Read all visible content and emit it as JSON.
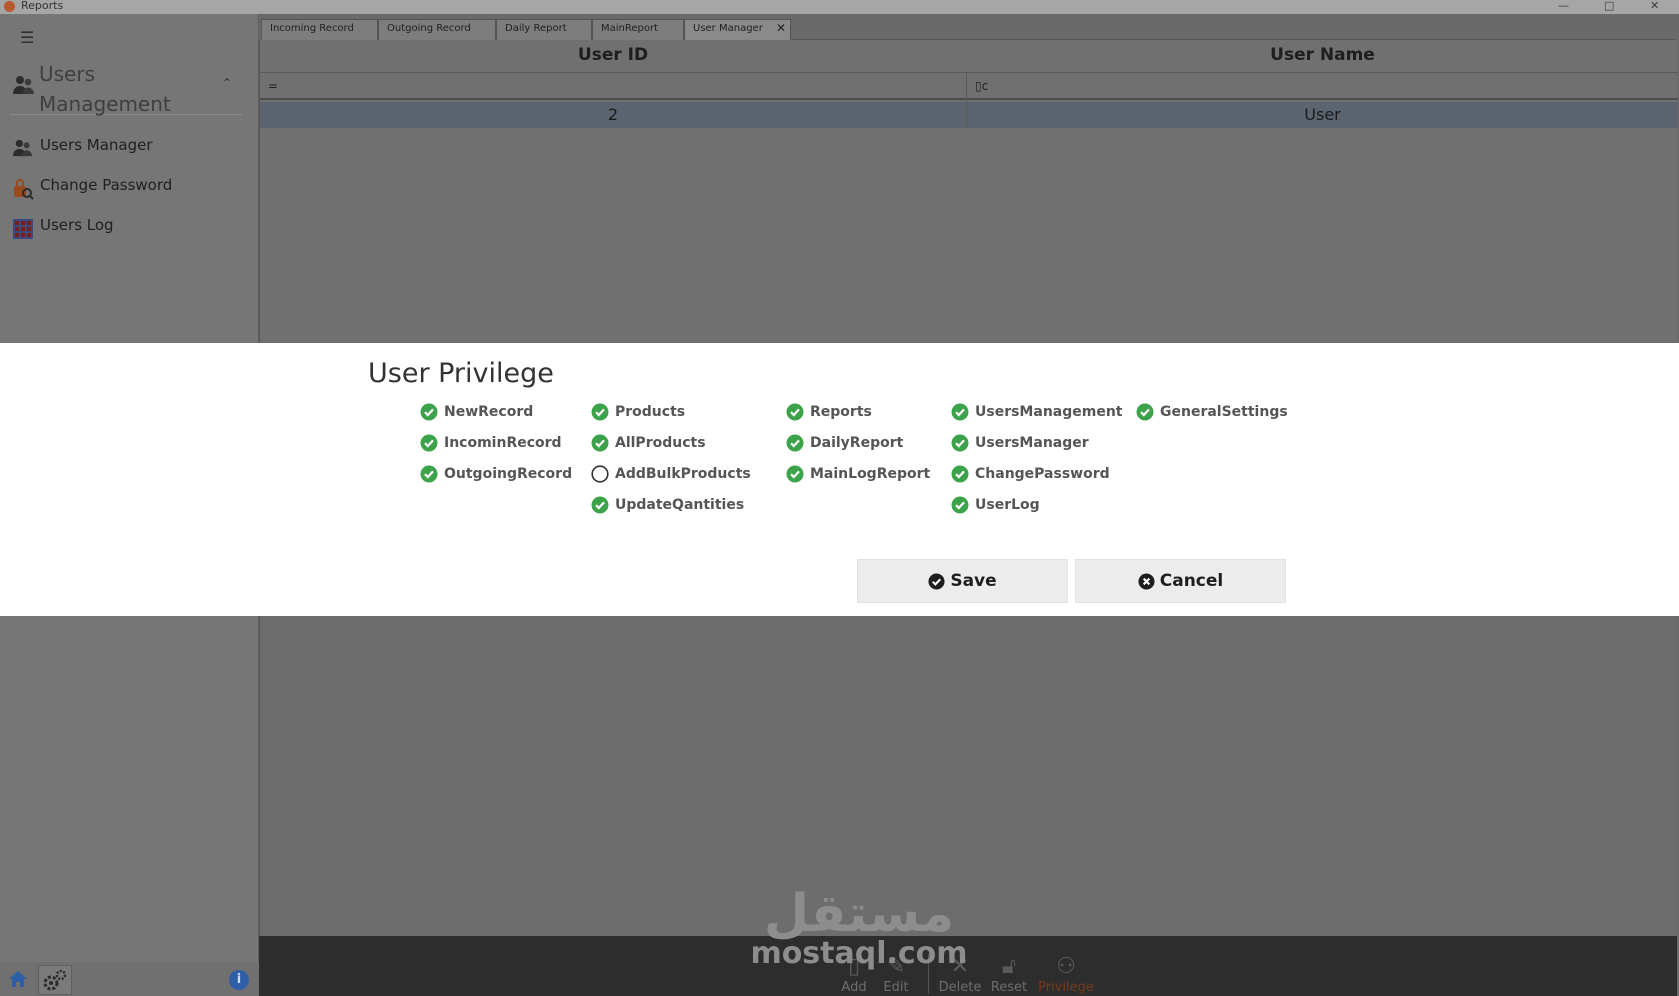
{
  "window": {
    "title": "Reports",
    "minimize_glyph": "—",
    "maximize_glyph": "□",
    "close_glyph": "✕"
  },
  "sidebar": {
    "menu_icon": "hamburger-icon",
    "group_title": "Users Management",
    "items": [
      {
        "label": "Users Manager",
        "icon": "users-icon"
      },
      {
        "label": "Change Password",
        "icon": "key-lock-icon"
      },
      {
        "label": "Users Log",
        "icon": "grid-table-icon"
      }
    ],
    "info_glyph": "i"
  },
  "tabs": [
    {
      "label": "Incoming Record"
    },
    {
      "label": "Outgoing Record"
    },
    {
      "label": "Daily Report"
    },
    {
      "label": "MainReport"
    },
    {
      "label": "User Manager",
      "active": true,
      "close": "✕"
    }
  ],
  "grid": {
    "columns": [
      "User ID",
      "User Name"
    ],
    "filters": [
      "=",
      "▯c"
    ],
    "rows": [
      {
        "id": "2",
        "name": "User"
      }
    ]
  },
  "dialog": {
    "title": "User Privilege",
    "privileges": [
      [
        {
          "label": "NewRecord",
          "checked": true
        },
        {
          "label": "IncominRecord",
          "checked": true
        },
        {
          "label": "OutgoingRecord",
          "checked": true
        }
      ],
      [
        {
          "label": "Products",
          "checked": true
        },
        {
          "label": "AllProducts",
          "checked": true
        },
        {
          "label": "AddBulkProducts",
          "checked": false
        },
        {
          "label": "UpdateQantities",
          "checked": true
        }
      ],
      [
        {
          "label": "Reports",
          "checked": true
        },
        {
          "label": "DailyReport",
          "checked": true
        },
        {
          "label": "MainLogReport",
          "checked": true
        }
      ],
      [
        {
          "label": "UsersManagement",
          "checked": true
        },
        {
          "label": "UsersManager",
          "checked": true
        },
        {
          "label": "ChangePassword",
          "checked": true
        },
        {
          "label": "UserLog",
          "checked": true
        }
      ],
      [
        {
          "label": "GeneralSettings",
          "checked": true
        }
      ]
    ],
    "save_label": "Save",
    "cancel_label": "Cancel"
  },
  "toolbar": {
    "add": "Add",
    "edit": "Edit",
    "delete": "Delete",
    "reset": "Reset",
    "privilege": "Privilege"
  },
  "watermark": {
    "arabic": "مستقل",
    "latin": "mostaql.com"
  },
  "colors": {
    "check_green": "#3da34a",
    "dialog_bg": "#ffffff",
    "overlay_bg": "#6a6a6a",
    "selected_row": "#5c6470",
    "privilege_label": "#7a3a1e"
  }
}
